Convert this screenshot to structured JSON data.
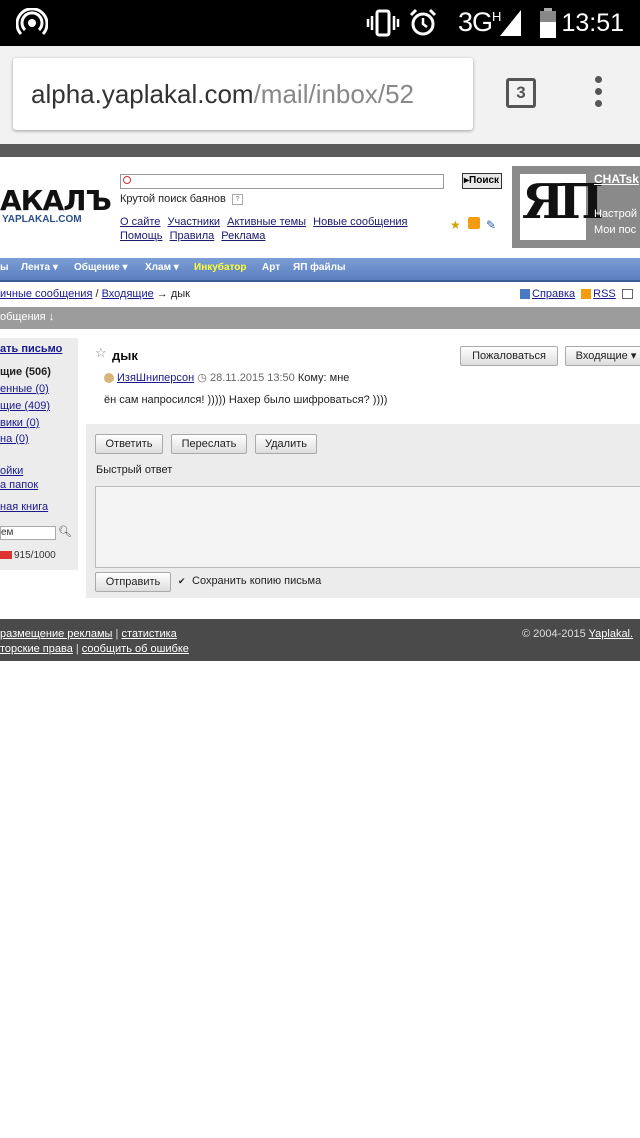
{
  "status_bar": {
    "network": "3G",
    "network_sup": "H",
    "time": "13:51"
  },
  "browser": {
    "url_host": "alpha.yaplakal.com",
    "url_path": "/mail/inbox/52",
    "tab_count": "3"
  },
  "site": {
    "logo": "АКАЛЪ",
    "logo_sub": "YAPLAKAL.COM",
    "search_button": "Поиск",
    "tagline": "Крутой поиск баянов",
    "help": "?",
    "top_links": [
      "О сайте",
      "Участники",
      "Активные темы",
      "Новые сообщения",
      "Помощь",
      "Правила",
      "Реклама"
    ],
    "profile": {
      "avatar_text": "ЯП",
      "name": "CHATsk",
      "line1": "Настрой",
      "line2": "Мои пос"
    }
  },
  "nav": {
    "items": [
      "ы",
      "Лента ▾",
      "Общение ▾",
      "Хлам ▾",
      "Инкубатор",
      "Арт",
      "ЯП файлы"
    ]
  },
  "breadcrumb": {
    "part1": "ичные сообщения",
    "sep": " / ",
    "part2": "Входящие",
    "current": " → дык"
  },
  "right_links": {
    "help": "Справка",
    "rss": "RSS"
  },
  "section_bar": "общения ↓",
  "sidebar": {
    "compose": "ать письмо",
    "folders": [
      "щие (506)",
      "енные (0)",
      "щие (409)",
      "вики (0)",
      "на (0)"
    ],
    "settings": "ойки",
    "folders_link": "а папок",
    "address_book": "ная книга",
    "search_value": "ем",
    "quota": "915/1000"
  },
  "message": {
    "subject": "дык",
    "report_button": "Пожаловаться",
    "folder_select": "Входящие ▾",
    "author": "ИзяШниперсон",
    "date": "28.11.2015 13:50",
    "to_label": "Кому: мне",
    "body": "ён сам напросился! ))))) Нахер было шифроваться? ))))",
    "reply_button": "Ответить",
    "forward_button": "Переслать",
    "delete_button": "Удалить",
    "quick_reply_label": "Быстрый ответ",
    "send_button": "Отправить",
    "keep_copy_label": "Сохранить копию письма"
  },
  "footer": {
    "ads": "размещение рекламы",
    "stats": "статистика",
    "copyright_link": "торские права",
    "report_error": "сообщить об ошибке",
    "copyright": "© 2004-2015",
    "site_link": "Yaplakal."
  }
}
